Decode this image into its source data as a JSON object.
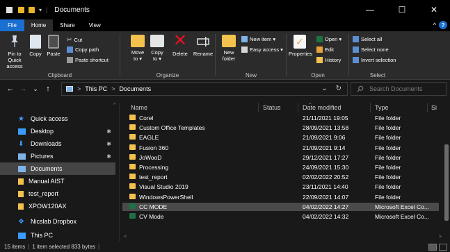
{
  "window": {
    "title": "Documents",
    "controls": {
      "minimize": "—",
      "maximize": "☐",
      "close": "✕"
    }
  },
  "ribbon_tabs": [
    "File",
    "Home",
    "Share",
    "View"
  ],
  "ribbon_right": {
    "collapse": "^",
    "help": "?"
  },
  "ribbon": {
    "clipboard": {
      "label": "Clipboard",
      "pin": "Pin to Quick access",
      "copy": "Copy",
      "paste": "Paste",
      "cut": "Cut",
      "copy_path": "Copy path",
      "paste_shortcut": "Paste shortcut"
    },
    "organize": {
      "label": "Organize",
      "move_to": "Move to ▾",
      "copy_to": "Copy to ▾",
      "delete": "Delete",
      "rename": "Rename"
    },
    "new": {
      "label": "New",
      "new_folder": "New folder",
      "new_item": "New item ▾",
      "easy_access": "Easy access ▾"
    },
    "open": {
      "label": "Open",
      "properties": "Properties",
      "open": "Open ▾",
      "edit": "Edit",
      "history": "History"
    },
    "select": {
      "label": "Select",
      "select_all": "Select all",
      "select_none": "Select none",
      "invert": "Invert selection"
    }
  },
  "navigation": {
    "back": "←",
    "forward": "→",
    "recent": "⌄",
    "up": "↑",
    "breadcrumb": [
      "This PC",
      "Documents"
    ],
    "sep": ">",
    "dropdown": "⌄",
    "refresh": "↻",
    "search_placeholder": "Search Documents"
  },
  "sidebar": {
    "items": [
      {
        "label": "Quick access",
        "icon": "star-icon",
        "pinned": false
      },
      {
        "label": "Desktop",
        "icon": "desktop-icon",
        "pinned": true
      },
      {
        "label": "Downloads",
        "icon": "download-icon",
        "pinned": true
      },
      {
        "label": "Pictures",
        "icon": "pictures-icon",
        "pinned": true
      },
      {
        "label": "Documents",
        "icon": "documents-icon",
        "pinned": false,
        "selected": true
      },
      {
        "label": "Manual AIST",
        "icon": "folder-icon",
        "pinned": false
      },
      {
        "label": "test_report",
        "icon": "folder-icon",
        "pinned": false
      },
      {
        "label": "XPOW120AX",
        "icon": "folder-icon",
        "pinned": false
      },
      {
        "label": "Nicslab Dropbox",
        "icon": "dropbox-icon",
        "pinned": false
      },
      {
        "label": "This PC",
        "icon": "pc-icon",
        "pinned": false
      }
    ],
    "pin_glyph": "📌"
  },
  "file_list": {
    "columns": [
      "Name",
      "Status",
      "Date modified",
      "Type",
      "Si"
    ],
    "rows": [
      {
        "name": "Corel",
        "status": "",
        "date": "21/11/2021 19:05",
        "type": "File folder",
        "kind": "folder"
      },
      {
        "name": "Custom Office Templates",
        "status": "",
        "date": "28/09/2021 13:58",
        "type": "File folder",
        "kind": "folder"
      },
      {
        "name": "EAGLE",
        "status": "",
        "date": "21/09/2021 9:06",
        "type": "File folder",
        "kind": "folder"
      },
      {
        "name": "Fusion 360",
        "status": "",
        "date": "21/09/2021 9:14",
        "type": "File folder",
        "kind": "folder"
      },
      {
        "name": "JoWooD",
        "status": "",
        "date": "29/12/2021 17:27",
        "type": "File folder",
        "kind": "folder"
      },
      {
        "name": "Processing",
        "status": "",
        "date": "24/09/2021 15:30",
        "type": "File folder",
        "kind": "folder"
      },
      {
        "name": "test_report",
        "status": "",
        "date": "02/02/2022 20:52",
        "type": "File folder",
        "kind": "folder"
      },
      {
        "name": "Visual Studio 2019",
        "status": "",
        "date": "23/11/2021 14:40",
        "type": "File folder",
        "kind": "folder"
      },
      {
        "name": "WindowsPowerShell",
        "status": "",
        "date": "22/09/2021 14:07",
        "type": "File folder",
        "kind": "folder"
      },
      {
        "name": "CC MODE",
        "status": "",
        "date": "04/02/2022 14:27",
        "type": "Microsoft Excel Co...",
        "kind": "excel",
        "selected": true
      },
      {
        "name": "CV Mode",
        "status": "",
        "date": "04/02/2022 14:32",
        "type": "Microsoft Excel Co...",
        "kind": "excel"
      }
    ]
  },
  "status_bar": {
    "items_count": "15 items",
    "selection": "1 item selected  833 bytes"
  },
  "colors": {
    "background": "#191919",
    "ribbon": "#2b2b2b",
    "file_tab": "#1a6fd1",
    "folder": "#f2c14e",
    "excel": "#1e7145",
    "selected_row": "#4a4a4a"
  }
}
